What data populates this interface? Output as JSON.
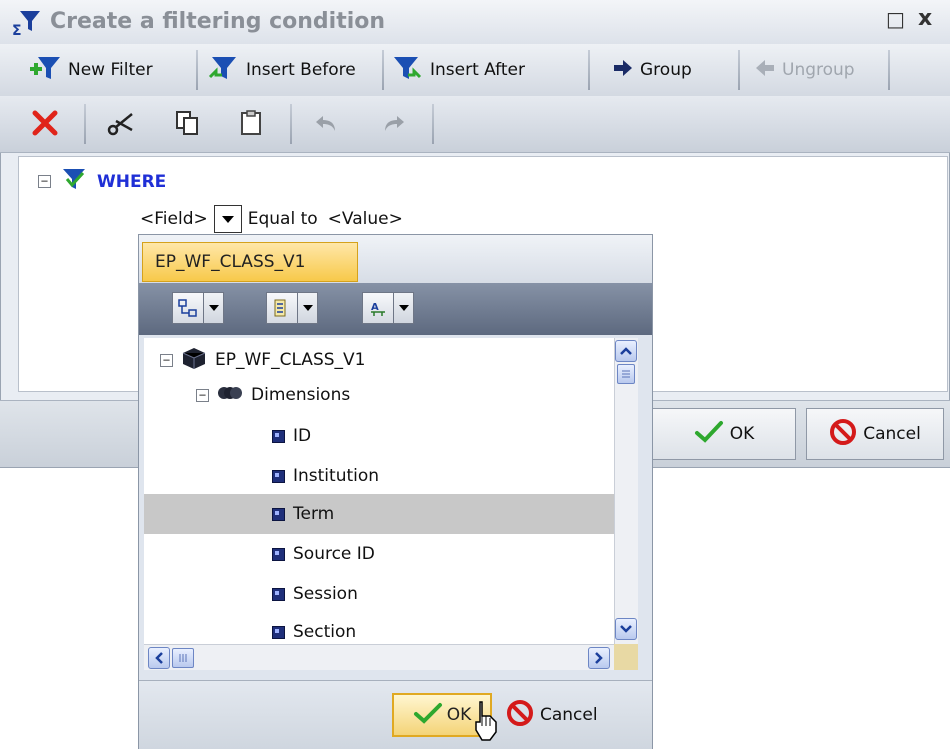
{
  "dialog": {
    "title": "Create a filtering condition",
    "maximize_glyph": "□",
    "close_glyph": "x"
  },
  "toolbar": {
    "new_filter": "New Filter",
    "insert_before": "Insert Before",
    "insert_after": "Insert After",
    "group": "Group",
    "ungroup": "Ungroup",
    "icons": [
      "delete-icon",
      "cut-icon",
      "copy-icon",
      "paste-icon",
      "undo-icon",
      "redo-icon"
    ]
  },
  "condition": {
    "where_label": "WHERE",
    "field_placeholder": "<Field>",
    "operator": "Equal to",
    "value_placeholder": "<Value>"
  },
  "dialog_buttons": {
    "ok": "OK",
    "cancel": "Cancel"
  },
  "popup": {
    "tab_label": "EP_WF_CLASS_V1",
    "tree": {
      "root": "EP_WF_CLASS_V1",
      "group": "Dimensions",
      "items": [
        "ID",
        "Institution",
        "Term",
        "Source ID",
        "Session",
        "Section"
      ],
      "selected": "Term"
    },
    "ok": "OK",
    "cancel": "Cancel"
  },
  "colors": {
    "where_blue": "#1f2fd6",
    "tab_gold": "#f7c94a",
    "delete_red": "#e0241a",
    "ok_green": "#2ea82e",
    "cancel_red": "#d41a1a"
  }
}
